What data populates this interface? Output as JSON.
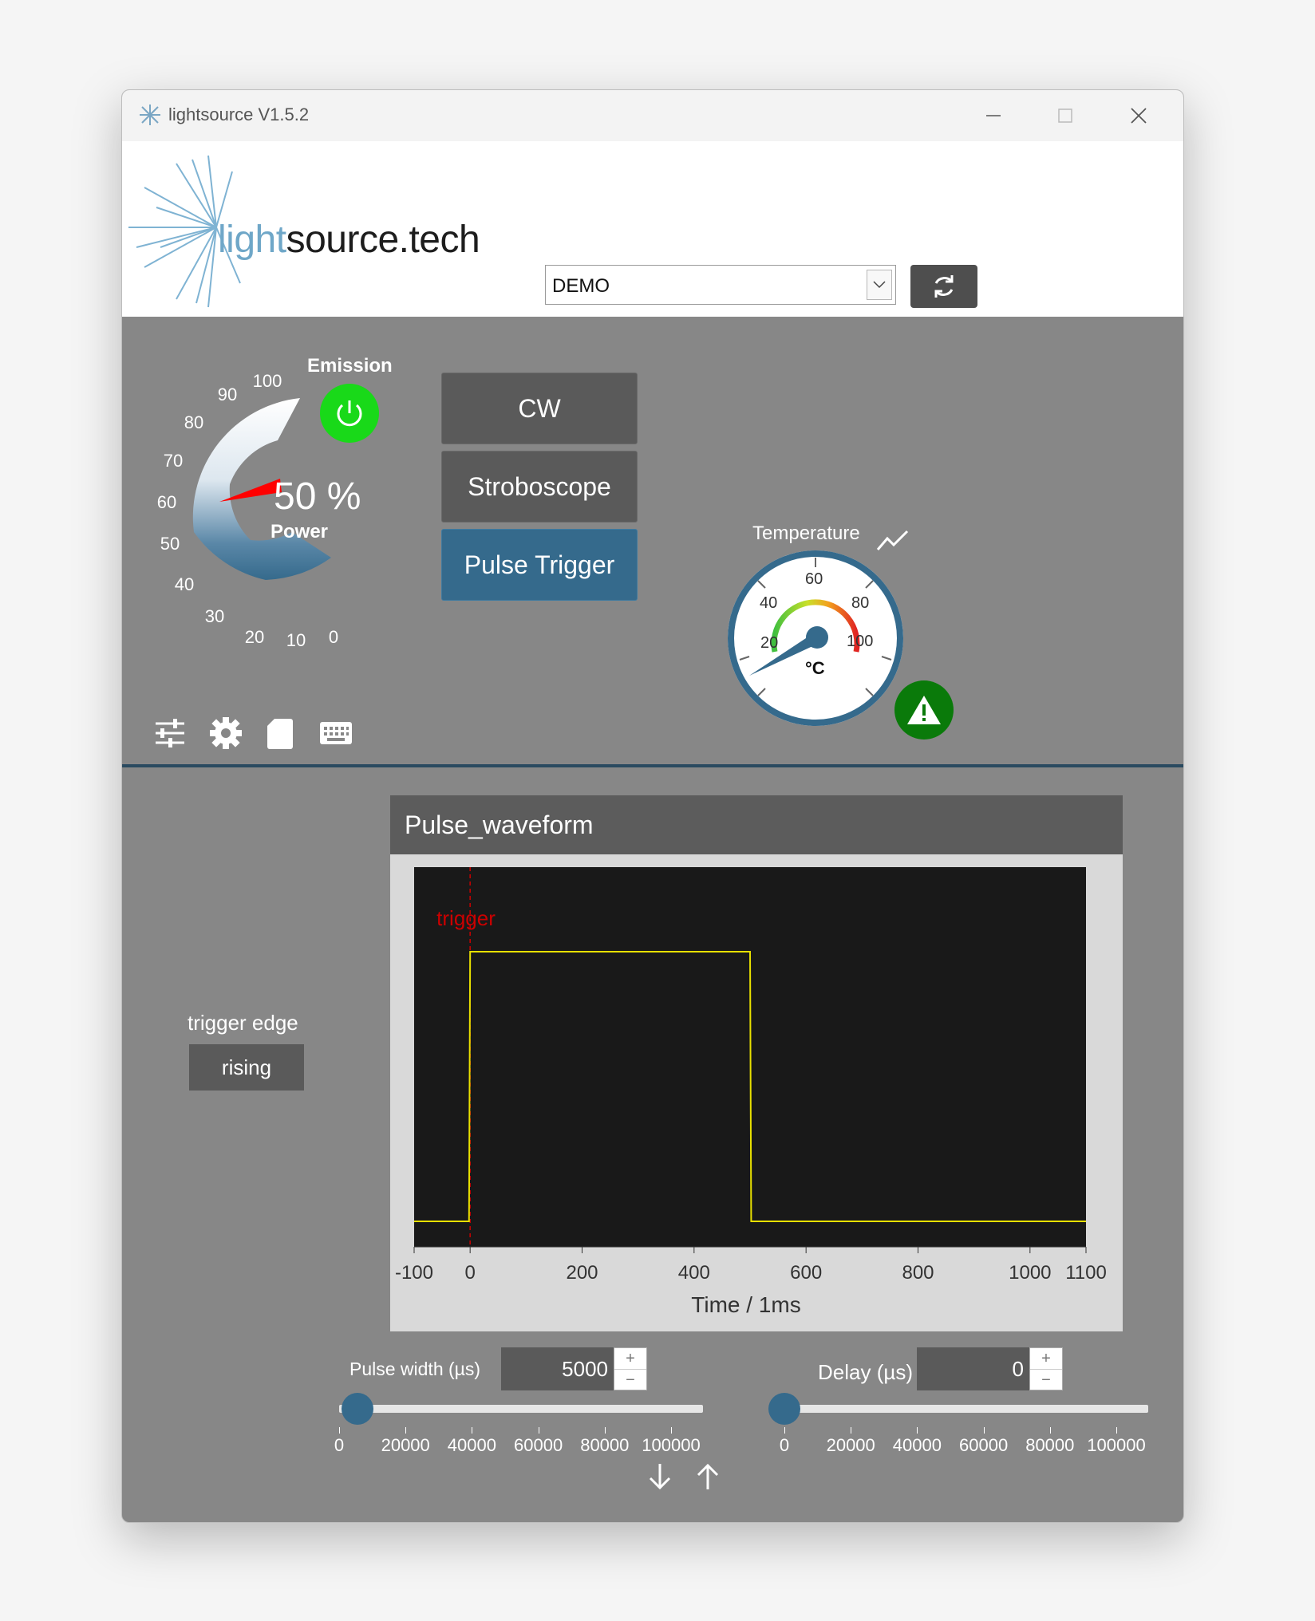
{
  "window": {
    "title": "lightsource V1.5.2"
  },
  "header": {
    "logo_light": "light",
    "logo_rest": "source.tech",
    "device_select_value": "DEMO"
  },
  "power": {
    "value_text": "50 %",
    "label": "Power",
    "level_percent": 50,
    "scale": [
      "100",
      "90",
      "80",
      "70",
      "60",
      "50",
      "40",
      "30",
      "20",
      "10",
      "0"
    ]
  },
  "emission": {
    "label": "Emission",
    "on": true
  },
  "modes": [
    {
      "label": "CW",
      "active": false
    },
    {
      "label": "Stroboscope",
      "active": false
    },
    {
      "label": "Pulse Trigger",
      "active": true
    }
  ],
  "temperature": {
    "label": "Temperature",
    "unit": "°C",
    "scale": [
      "20",
      "40",
      "60",
      "80",
      "100"
    ],
    "value": 22
  },
  "toolbar_icons": [
    "sliders-icon",
    "gear-icon",
    "sd-card-icon",
    "keyboard-icon"
  ],
  "trigger": {
    "edge_label": "trigger edge",
    "edge_value": "rising"
  },
  "chart_data": {
    "type": "line",
    "title": "Pulse_waveform",
    "xlabel": "Time / 1ms",
    "ylabel": "",
    "xlim": [
      -100,
      1100
    ],
    "x_ticks": [
      "-100",
      "0",
      "200",
      "400",
      "600",
      "800",
      "1000",
      "1100"
    ],
    "annotation": "trigger",
    "trigger_x": 0,
    "series": [
      {
        "x": [
          -100,
          -2,
          0,
          500,
          502,
          1100
        ],
        "y": [
          0,
          0,
          1,
          1,
          0,
          0
        ],
        "color": "#e8e000"
      }
    ]
  },
  "pulse_width": {
    "label": "Pulse width (µs)",
    "value": "5000",
    "slider_value": 5000,
    "slider_max": 100000,
    "ticks": [
      "0",
      "20000",
      "40000",
      "60000",
      "80000",
      "100000"
    ]
  },
  "delay": {
    "label": "Delay (µs)",
    "value": "0",
    "slider_value": 0,
    "slider_max": 100000,
    "ticks": [
      "0",
      "20000",
      "40000",
      "60000",
      "80000",
      "100000"
    ]
  },
  "colors": {
    "accent": "#356a8c",
    "emission_on": "#19d919",
    "warning_ok": "#0a7a0a",
    "trace": "#e8e000",
    "trigger_line": "#cc0000"
  }
}
